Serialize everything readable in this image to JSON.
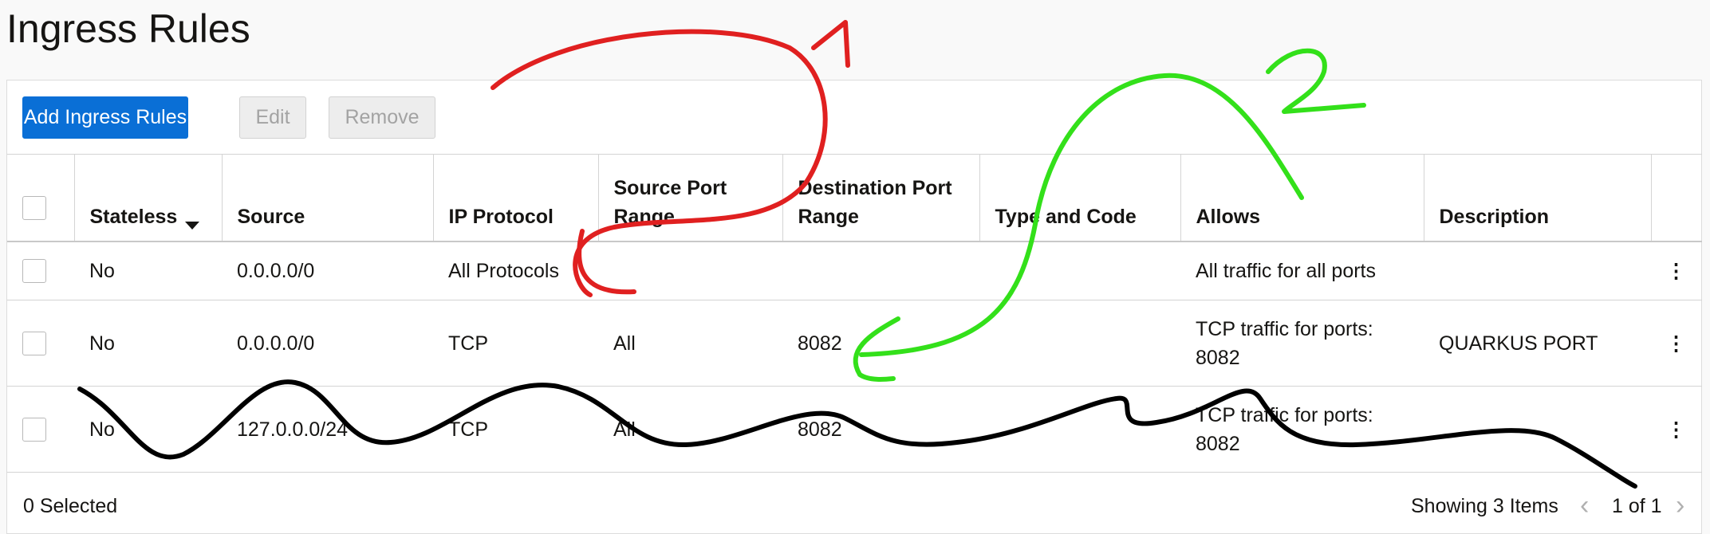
{
  "page": {
    "title": "Ingress Rules"
  },
  "toolbar": {
    "add_label": "Add Ingress Rules",
    "edit_label": "Edit",
    "remove_label": "Remove"
  },
  "table": {
    "headers": {
      "stateless": "Stateless",
      "source": "Source",
      "ip_protocol": "IP Protocol",
      "source_port_range": "Source Port Range",
      "destination_port_range": "Destination Port Range",
      "type_and_code": "Type and Code",
      "allows": "Allows",
      "description": "Description"
    },
    "rows": [
      {
        "stateless": "No",
        "source": "0.0.0.0/0",
        "ip_protocol": "All Protocols",
        "source_port_range": "",
        "destination_port_range": "",
        "type_and_code": "",
        "allows": "All traffic for all ports",
        "description": ""
      },
      {
        "stateless": "No",
        "source": "0.0.0.0/0",
        "ip_protocol": "TCP",
        "source_port_range": "All",
        "destination_port_range": "8082",
        "type_and_code": "",
        "allows": "TCP traffic for ports: 8082",
        "description": "QUARKUS PORT"
      },
      {
        "stateless": "No",
        "source": "127.0.0.0/24",
        "ip_protocol": "TCP",
        "source_port_range": "All",
        "destination_port_range": "8082",
        "type_and_code": "",
        "allows": "TCP traffic for ports: 8082",
        "description": ""
      }
    ],
    "row_menu_icon": "kebab-icon"
  },
  "footer": {
    "selected": "0 Selected",
    "showing": "Showing 3 Items",
    "pagination": "1 of 1"
  },
  "annotations": {
    "label_1": "1",
    "label_2": "2",
    "color_red": "#e02020",
    "color_green": "#33e01a",
    "color_black": "#000000"
  },
  "colors": {
    "primary": "#0a6fd6"
  }
}
